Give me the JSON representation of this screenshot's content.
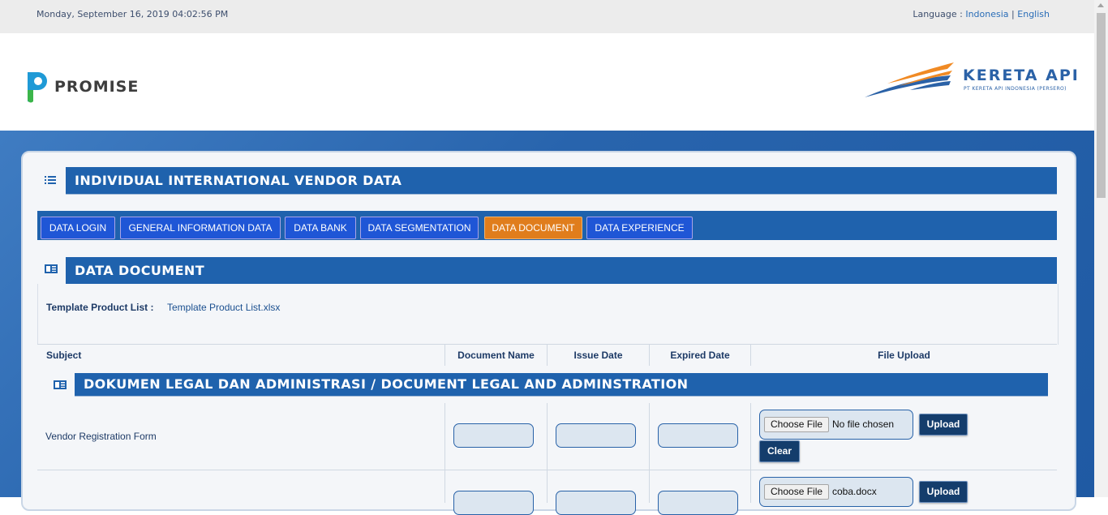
{
  "topbar": {
    "datetime": "Monday, September 16, 2019 04:02:56 PM",
    "language_label": "Language :",
    "lang_id": "Indonesia",
    "separator": "|",
    "lang_en": "English"
  },
  "header": {
    "brand": "PROMISE",
    "partner_name": "KERETA API",
    "partner_sub": "PT KERETA API INDONESIA (PERSERO)"
  },
  "page": {
    "title": "INDIVIDUAL INTERNATIONAL VENDOR DATA"
  },
  "tabs": [
    {
      "label": "DATA LOGIN",
      "active": false
    },
    {
      "label": "GENERAL INFORMATION DATA",
      "active": false
    },
    {
      "label": "DATA BANK",
      "active": false
    },
    {
      "label": "DATA SEGMENTATION",
      "active": false
    },
    {
      "label": "DATA DOCUMENT",
      "active": true
    },
    {
      "label": "DATA EXPERIENCE",
      "active": false
    }
  ],
  "section": {
    "title": "DATA DOCUMENT",
    "template_label": "Template Product List :",
    "template_link": "Template Product List.xlsx"
  },
  "table": {
    "headers": [
      "Subject",
      "Document Name",
      "Issue Date",
      "Expired Date",
      "File Upload"
    ],
    "group_title": "DOKUMEN LEGAL DAN ADMINISTRASI / DOCUMENT LEGAL AND ADMINSTRATION",
    "rows": [
      {
        "subject": "Vendor Registration Form",
        "file": "No file chosen",
        "choose_label": "Choose File",
        "upload_label": "Upload",
        "clear_label": "Clear"
      },
      {
        "subject": "",
        "file": "coba.docx",
        "choose_label": "Choose File",
        "upload_label": "Upload"
      }
    ]
  },
  "colors": {
    "primary_blue": "#1f62ad",
    "tab_blue": "#1f56d6",
    "tab_active": "#e07d1c",
    "button_dark": "#143d6c"
  }
}
